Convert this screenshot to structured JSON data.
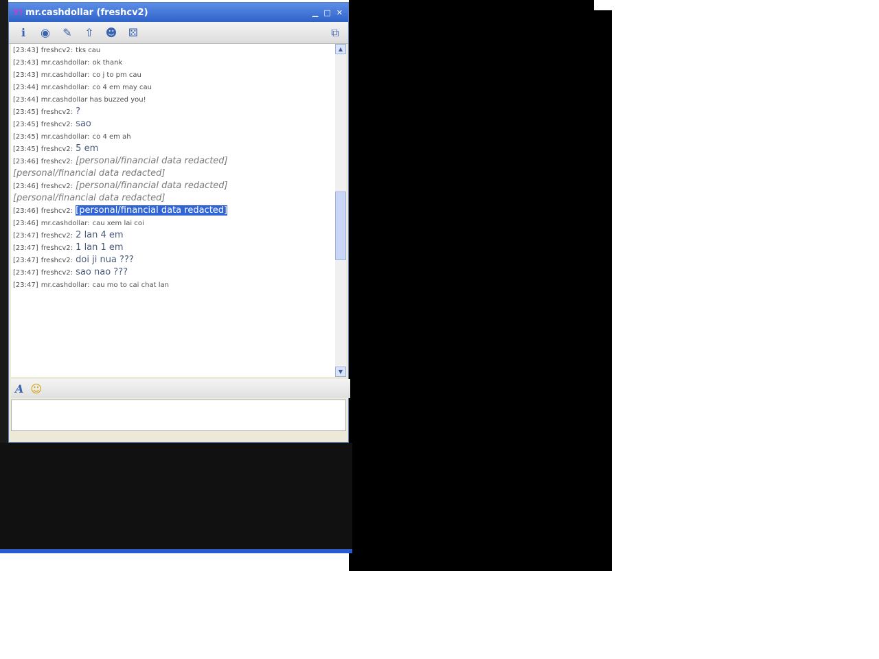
{
  "window": {
    "title": "mr.cashdollar (freshcv2)",
    "app_icon": "yahoo-messenger-icon",
    "controls": [
      "minimize",
      "maximize",
      "close"
    ]
  },
  "toolbar": {
    "icons": [
      "info-icon",
      "webcam-icon",
      "notepad-icon",
      "send-file-icon",
      "contacts-icon",
      "games-icon"
    ],
    "right_icon": "popout-icon"
  },
  "chat": {
    "messages": [
      {
        "ts": "[23:43]",
        "who": "freshcv2:",
        "text": "tks cau",
        "small": true
      },
      {
        "ts": "[23:43]",
        "who": "mr.cashdollar:",
        "text": "ok thank",
        "small": true
      },
      {
        "ts": "[23:43]",
        "who": "mr.cashdollar:",
        "text": "co j to pm cau",
        "small": true
      },
      {
        "ts": "[23:44]",
        "who": "mr.cashdollar:",
        "text": "co 4 em may cau",
        "small": true
      },
      {
        "ts": "[23:44]",
        "who": "mr.cashdollar has buzzed you!",
        "text": "",
        "small": true
      },
      {
        "ts": "[23:45]",
        "who": "freshcv2:",
        "text": "?",
        "small": false
      },
      {
        "ts": "[23:45]",
        "who": "freshcv2:",
        "text": "sao",
        "small": false
      },
      {
        "ts": "[23:45]",
        "who": "mr.cashdollar:",
        "text": "co 4 em ah",
        "small": true
      },
      {
        "ts": "[23:45]",
        "who": "freshcv2:",
        "text": "5 em",
        "small": false
      },
      {
        "ts": "[23:46]",
        "who": "freshcv2:",
        "text": "[personal/financial data redacted]",
        "redacted": true
      },
      {
        "ts": "",
        "who": "",
        "text": "[personal/financial data redacted]",
        "redacted": true
      },
      {
        "ts": "[23:46]",
        "who": "freshcv2:",
        "text": "[personal/financial data redacted]",
        "redacted": true
      },
      {
        "ts": "",
        "who": "",
        "text": "[personal/financial data redacted]",
        "redacted": true
      },
      {
        "ts": "[23:46]",
        "who": "freshcv2:",
        "text": "[personal/financial data redacted]",
        "redacted": true,
        "selected": true
      },
      {
        "ts": "[23:46]",
        "who": "mr.cashdollar:",
        "text": "cau xem lai coi",
        "small": true
      },
      {
        "ts": "[23:47]",
        "who": "freshcv2:",
        "text": "2 lan 4 em",
        "small": false
      },
      {
        "ts": "[23:47]",
        "who": "freshcv2:",
        "text": "1 lan 1 em",
        "small": false
      },
      {
        "ts": "[23:47]",
        "who": "freshcv2:",
        "text": "doi ji nua ???",
        "small": false
      },
      {
        "ts": "[23:47]",
        "who": "freshcv2:",
        "text": "sao nao ???",
        "small": false
      },
      {
        "ts": "[23:47]",
        "who": "mr.cashdollar:",
        "text": "cau mo to cai chat lan",
        "small": true
      }
    ]
  },
  "format_bar": {
    "icons": [
      "font-icon",
      "emoticon-icon"
    ]
  },
  "input": {
    "value": ""
  }
}
